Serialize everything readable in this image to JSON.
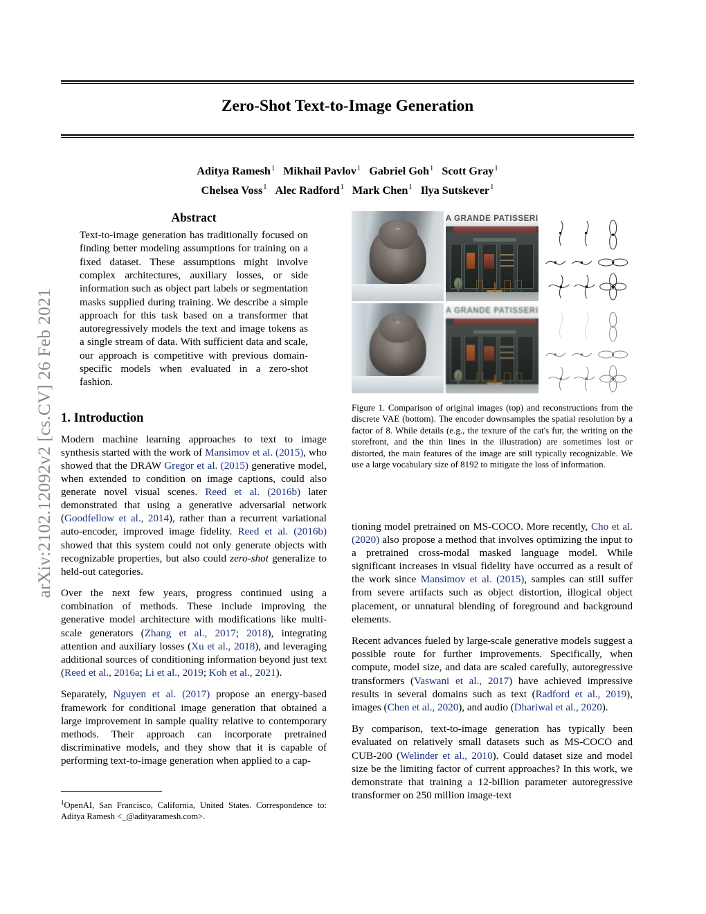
{
  "arxiv_stamp": "arXiv:2102.12092v2  [cs.CV]  26 Feb 2021",
  "title": "Zero-Shot Text-to-Image Generation",
  "authors": {
    "line1": [
      {
        "name": "Aditya Ramesh",
        "aff": "1"
      },
      {
        "name": "Mikhail Pavlov",
        "aff": "1"
      },
      {
        "name": "Gabriel Goh",
        "aff": "1"
      },
      {
        "name": "Scott Gray",
        "aff": "1"
      }
    ],
    "line2": [
      {
        "name": "Chelsea Voss",
        "aff": "1"
      },
      {
        "name": "Alec Radford",
        "aff": "1"
      },
      {
        "name": "Mark Chen",
        "aff": "1"
      },
      {
        "name": "Ilya Sutskever",
        "aff": "1"
      }
    ]
  },
  "abstract": {
    "heading": "Abstract",
    "body": "Text-to-image generation has traditionally focused on finding better modeling assumptions for training on a fixed dataset. These assumptions might involve complex architectures, auxiliary losses, or side information such as object part labels or segmentation masks supplied during training. We describe a simple approach for this task based on a transformer that autoregressively models the text and image tokens as a single stream of data. With sufficient data and scale, our approach is competitive with previous domain-specific models when evaluated in a zero-shot fashion."
  },
  "introduction": {
    "heading": "1. Introduction",
    "p1": {
      "s1": "Modern machine learning approaches to text to image synthesis started with the work of ",
      "c1": "Mansimov et al. (2015)",
      "s2": ", who showed that the DRAW ",
      "c2": "Gregor et al. (2015)",
      "s3": " generative model, when extended to condition on image captions, could also generate novel visual scenes. ",
      "c3": "Reed et al. (2016b)",
      "s4": " later demonstrated that using a generative adversarial network (",
      "c4": "Goodfellow et al., 2014",
      "s5": "), rather than a recurrent variational auto-encoder, improved image fidelity. ",
      "c5": "Reed et al. (2016b)",
      "s6": " showed that this system could not only generate objects with recognizable properties, but also could ",
      "em1": "zero-shot",
      "s7": " generalize to held-out categories."
    },
    "p2": {
      "s1": "Over the next few years, progress continued using a combination of methods. These include improving the generative model architecture with modifications like multi-scale generators (",
      "c1": "Zhang et al., 2017",
      "s2": "; ",
      "c2": "2018",
      "s3": "), integrating attention and auxiliary losses (",
      "c3": "Xu et al., 2018",
      "s4": "), and leveraging additional sources of conditioning information beyond just text (",
      "c4": "Reed et al., 2016a",
      "s5": "; ",
      "c5": "Li et al., 2019",
      "s6": "; ",
      "c6": "Koh et al., 2021",
      "s7": ")."
    },
    "p3": {
      "s1": "Separately, ",
      "c1": "Nguyen et al. (2017)",
      "s2": " propose an energy-based framework for conditional image generation that obtained a large improvement in sample quality relative to contemporary methods. Their approach can incorporate pretrained discriminative models, and they show that it is capable of performing text-to-image generation when applied to a cap-"
    },
    "p4": {
      "s1": "tioning model pretrained on MS-COCO. More recently, ",
      "c1": "Cho et al. (2020)",
      "s2": " also propose a method that involves optimizing the input to a pretrained cross-modal masked language model. While significant increases in visual fidelity have occurred as a result of the work since ",
      "c2": "Mansimov et al. (2015)",
      "s3": ", samples can still suffer from severe artifacts such as object distortion, illogical object placement, or unnatural blending of foreground and background elements."
    },
    "p5": {
      "s1": "Recent advances fueled by large-scale generative models suggest a possible route for further improvements. Specifically, when compute, model size, and data are scaled carefully, autoregressive transformers (",
      "c1": "Vaswani et al., 2017",
      "s2": ") have achieved impressive results in several domains such as text (",
      "c2": "Radford et al., 2019",
      "s3": "), images (",
      "c3": "Chen et al., 2020",
      "s4": "), and audio (",
      "c4": "Dhariwal et al., 2020",
      "s5": ")."
    },
    "p6": {
      "s1": "By comparison, text-to-image generation has typically been evaluated on relatively small datasets such as MS-COCO and CUB-200 (",
      "c1": "Welinder et al., 2010",
      "s2": "). Could dataset size and model size be the limiting factor of current approaches? In this work, we demonstrate that training a 12-billion parameter autoregressive transformer on 250 million image-text"
    }
  },
  "footnote": {
    "mark": "1",
    "text": "OpenAI, San Francisco, California, United States. Correspondence to: Aditya Ramesh <_@adityaramesh.com>."
  },
  "figure": {
    "caption": "Figure 1. Comparison of original images (top) and reconstructions from the discrete VAE (bottom). The encoder downsamples the spatial resolution by a factor of 8. While details (e.g., the texture of the cat's fur, the writing on the storefront, and the thin lines in the illustration) are sometimes lost or distorted, the main features of the image are still typically recognizable. We use a large vocabulary size of 8192 to mitigate the loss of information.",
    "cells": [
      {
        "kind": "cat-photo",
        "row": "original",
        "label": "cat-original"
      },
      {
        "kind": "storefront-photo",
        "row": "original",
        "label": "storefront-original",
        "sign_text": "LA GRANDE PATISSERIE"
      },
      {
        "kind": "line-illustration",
        "row": "original",
        "label": "illustration-original"
      },
      {
        "kind": "cat-photo",
        "row": "reconstruction",
        "label": "cat-reconstruction"
      },
      {
        "kind": "storefront-photo",
        "row": "reconstruction",
        "label": "storefront-reconstruction",
        "sign_text": "LA GRANDE PATISSERIE"
      },
      {
        "kind": "line-illustration",
        "row": "reconstruction",
        "label": "illustration-reconstruction"
      }
    ]
  },
  "colors": {
    "citation_blue": "#17307e",
    "stamp_gray": "#8a8a8a",
    "text_black": "#000000",
    "awning_red": "#8e4a46",
    "facade_green": "#3b423f"
  }
}
